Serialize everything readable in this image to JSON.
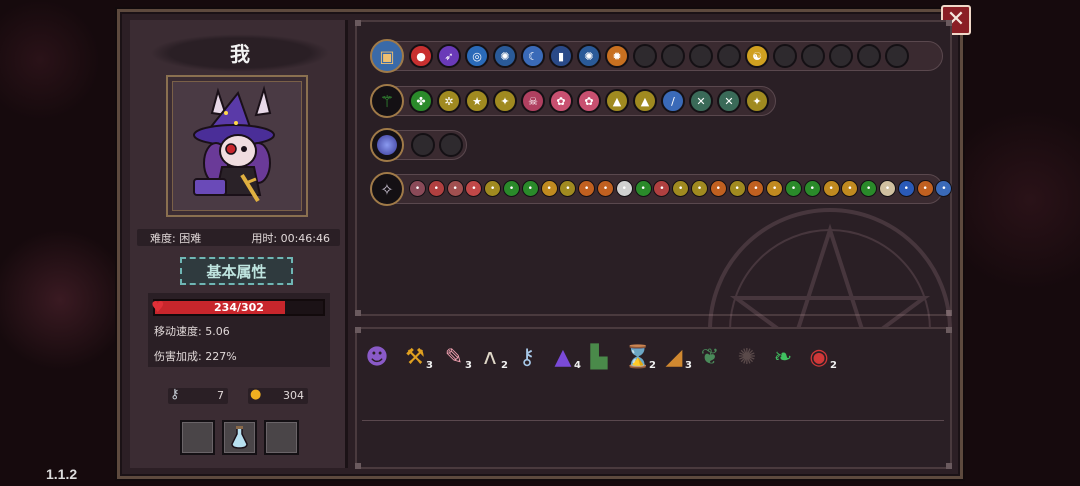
{
  "version": "1.1.2",
  "player": {
    "name": "我",
    "difficulty_label": "难度: 困难",
    "time_label": "用时: 00:46:46"
  },
  "attributes": {
    "title": "基本属性",
    "hp_text": "234/302",
    "hp_current": 234,
    "hp_max": 302,
    "move_speed": "移动速度: 5.06",
    "damage_bonus": "伤害加成: 227%"
  },
  "resources": {
    "keys": "7",
    "coins": "304"
  },
  "skill_rows": {
    "row1": {
      "head_icon": "chest-icon",
      "icons": [
        "bomb-icon",
        "arrow-icon",
        "spiral-icon",
        "splash-icon",
        "moon-icon",
        "bottle-icon",
        "splash-icon",
        "fire-icon"
      ],
      "empty_slots": 4,
      "special_icon": "yinyang-icon",
      "empty_slots_after": 5
    },
    "row2": {
      "head_icon": "staff-icon",
      "icons": [
        "clover-icon",
        "gear-icon",
        "star-icon",
        "sparkle-icon",
        "skull-icon",
        "flower-icon",
        "flower-icon",
        "arrow-up-icon",
        "arrow-up-icon",
        "blade-icon",
        "swords-icon",
        "swords-icon",
        "sparkle-icon"
      ]
    },
    "row3": {
      "head_icon": "orb-icon",
      "empty_slots": 2
    },
    "row4": {
      "head_icon": "rune-icon",
      "small_icons": 35
    }
  },
  "items": [
    {
      "icon": "witch-face-icon",
      "count": ""
    },
    {
      "icon": "pickaxe-icon",
      "count": "3"
    },
    {
      "icon": "feather-icon",
      "count": "3"
    },
    {
      "icon": "fangs-icon",
      "count": "2"
    },
    {
      "icon": "key-icon",
      "count": ""
    },
    {
      "icon": "witch-hat-icon",
      "count": "4"
    },
    {
      "icon": "boot-icon",
      "count": ""
    },
    {
      "icon": "hourglass-icon",
      "count": "2"
    },
    {
      "icon": "horn-icon",
      "count": "3"
    },
    {
      "icon": "dragon-icon",
      "count": ""
    },
    {
      "icon": "mane-icon",
      "count": ""
    },
    {
      "icon": "leaf-icon",
      "count": ""
    },
    {
      "icon": "eye-icon",
      "count": "2"
    }
  ],
  "close_label": "✕"
}
